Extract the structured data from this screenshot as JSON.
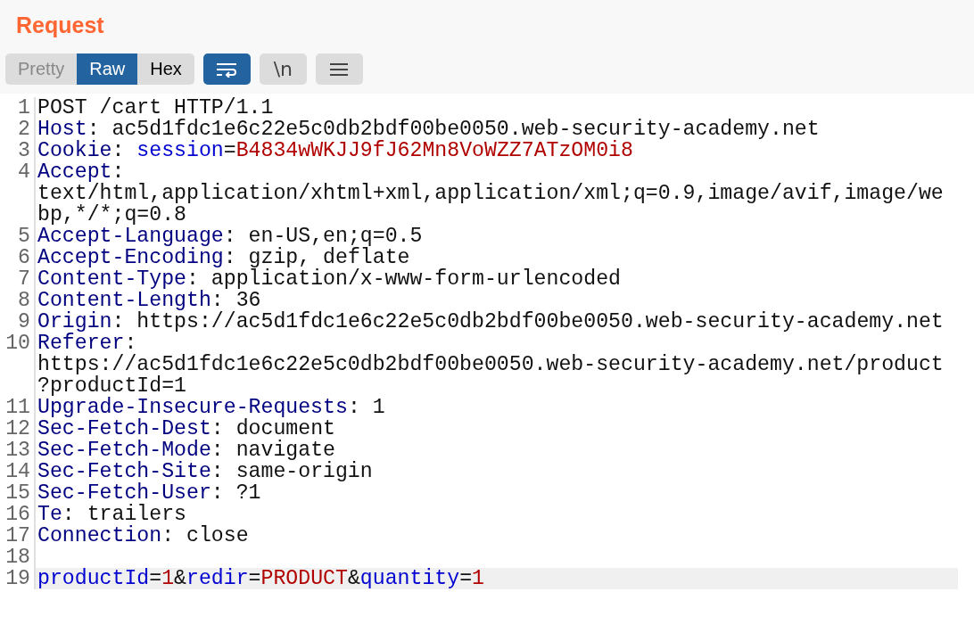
{
  "panel": {
    "title": "Request"
  },
  "view_tabs": [
    {
      "label": "Pretty",
      "selected": false
    },
    {
      "label": "Raw",
      "selected": true
    },
    {
      "label": "Hex",
      "selected": false
    }
  ],
  "toolbar": [
    {
      "kind": "wrap",
      "on": true
    },
    {
      "kind": "text",
      "label": "\\n",
      "on": false
    },
    {
      "kind": "menu",
      "on": false
    }
  ],
  "lines": [
    {
      "number": "1",
      "highlighted": false,
      "rows": [
        [
          {
            "kind": "plain",
            "text": "POST /cart HTTP/1.1"
          }
        ]
      ]
    },
    {
      "number": "2",
      "highlighted": false,
      "rows": [
        [
          {
            "kind": "header",
            "text": "Host"
          },
          {
            "kind": "plain",
            "text": ": ac5d1fdc1e6c22e5c0db2bdf00be0050.web-security-academy.net"
          }
        ]
      ]
    },
    {
      "number": "3",
      "highlighted": false,
      "rows": [
        [
          {
            "kind": "header",
            "text": "Cookie"
          },
          {
            "kind": "plain",
            "text": ": "
          },
          {
            "kind": "param",
            "text": "session"
          },
          {
            "kind": "plain",
            "text": "="
          },
          {
            "kind": "value",
            "text": "B4834wWKJJ9fJ62Mn8VoWZZ7ATzOM0i8"
          }
        ]
      ]
    },
    {
      "number": "4",
      "highlighted": false,
      "rows": [
        [
          {
            "kind": "header",
            "text": "Accept"
          },
          {
            "kind": "plain",
            "text": ":"
          }
        ],
        [
          {
            "kind": "plain",
            "text": "text/html,application/xhtml+xml,application/xml;q=0.9,image/avif,image/we"
          }
        ],
        [
          {
            "kind": "plain",
            "text": "bp,*/*;q=0.8"
          }
        ]
      ]
    },
    {
      "number": "5",
      "highlighted": false,
      "rows": [
        [
          {
            "kind": "header",
            "text": "Accept-Language"
          },
          {
            "kind": "plain",
            "text": ": en-US,en;q=0.5"
          }
        ]
      ]
    },
    {
      "number": "6",
      "highlighted": false,
      "rows": [
        [
          {
            "kind": "header",
            "text": "Accept-Encoding"
          },
          {
            "kind": "plain",
            "text": ": gzip, deflate"
          }
        ]
      ]
    },
    {
      "number": "7",
      "highlighted": false,
      "rows": [
        [
          {
            "kind": "header",
            "text": "Content-Type"
          },
          {
            "kind": "plain",
            "text": ": application/x-www-form-urlencoded"
          }
        ]
      ]
    },
    {
      "number": "8",
      "highlighted": false,
      "rows": [
        [
          {
            "kind": "header",
            "text": "Content-Length"
          },
          {
            "kind": "plain",
            "text": ": 36"
          }
        ]
      ]
    },
    {
      "number": "9",
      "highlighted": false,
      "rows": [
        [
          {
            "kind": "header",
            "text": "Origin"
          },
          {
            "kind": "plain",
            "text": ": https://ac5d1fdc1e6c22e5c0db2bdf00be0050.web-security-academy.net"
          }
        ]
      ]
    },
    {
      "number": "10",
      "highlighted": false,
      "rows": [
        [
          {
            "kind": "header",
            "text": "Referer"
          },
          {
            "kind": "plain",
            "text": ":"
          }
        ],
        [
          {
            "kind": "plain",
            "text": "https://ac5d1fdc1e6c22e5c0db2bdf00be0050.web-security-academy.net/product"
          }
        ],
        [
          {
            "kind": "plain",
            "text": "?productId=1"
          }
        ]
      ]
    },
    {
      "number": "11",
      "highlighted": false,
      "rows": [
        [
          {
            "kind": "header",
            "text": "Upgrade-Insecure-Requests"
          },
          {
            "kind": "plain",
            "text": ": 1"
          }
        ]
      ]
    },
    {
      "number": "12",
      "highlighted": false,
      "rows": [
        [
          {
            "kind": "header",
            "text": "Sec-Fetch-Dest"
          },
          {
            "kind": "plain",
            "text": ": document"
          }
        ]
      ]
    },
    {
      "number": "13",
      "highlighted": false,
      "rows": [
        [
          {
            "kind": "header",
            "text": "Sec-Fetch-Mode"
          },
          {
            "kind": "plain",
            "text": ": navigate"
          }
        ]
      ]
    },
    {
      "number": "14",
      "highlighted": false,
      "rows": [
        [
          {
            "kind": "header",
            "text": "Sec-Fetch-Site"
          },
          {
            "kind": "plain",
            "text": ": same-origin"
          }
        ]
      ]
    },
    {
      "number": "15",
      "highlighted": false,
      "rows": [
        [
          {
            "kind": "header",
            "text": "Sec-Fetch-User"
          },
          {
            "kind": "plain",
            "text": ": ?1"
          }
        ]
      ]
    },
    {
      "number": "16",
      "highlighted": false,
      "rows": [
        [
          {
            "kind": "header",
            "text": "Te"
          },
          {
            "kind": "plain",
            "text": ": trailers"
          }
        ]
      ]
    },
    {
      "number": "17",
      "highlighted": false,
      "rows": [
        [
          {
            "kind": "header",
            "text": "Connection"
          },
          {
            "kind": "plain",
            "text": ": close"
          }
        ]
      ]
    },
    {
      "number": "18",
      "highlighted": false,
      "rows": [
        []
      ]
    },
    {
      "number": "19",
      "highlighted": true,
      "rows": [
        [
          {
            "kind": "param",
            "text": "productId"
          },
          {
            "kind": "plain",
            "text": "="
          },
          {
            "kind": "value",
            "text": "1"
          },
          {
            "kind": "plain",
            "text": "&"
          },
          {
            "kind": "param",
            "text": "redir"
          },
          {
            "kind": "plain",
            "text": "="
          },
          {
            "kind": "value",
            "text": "PRODUCT"
          },
          {
            "kind": "plain",
            "text": "&"
          },
          {
            "kind": "param",
            "text": "quantity"
          },
          {
            "kind": "plain",
            "text": "="
          },
          {
            "kind": "value",
            "text": "1"
          }
        ]
      ]
    }
  ]
}
